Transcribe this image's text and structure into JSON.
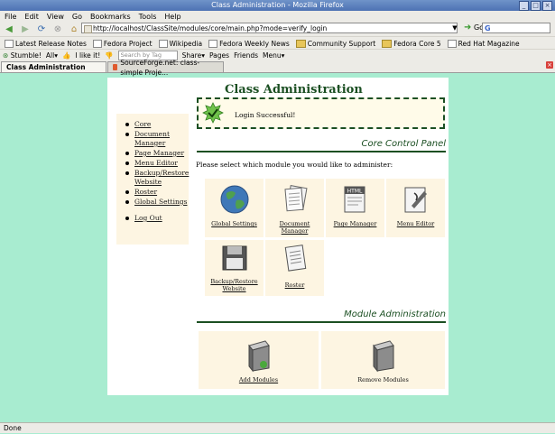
{
  "window": {
    "title": "Class Administration - Mozilla Firefox",
    "controls": [
      "_",
      "□",
      "×"
    ]
  },
  "menu": [
    "File",
    "Edit",
    "View",
    "Go",
    "Bookmarks",
    "Tools",
    "Help"
  ],
  "nav": {
    "url": "http://localhost/ClassSite/modules/core/main.php?mode=verify_login",
    "go_label": "Go",
    "search_value": "G"
  },
  "bookmarks": [
    "Latest Release Notes",
    "Fedora Project",
    "Wikipedia",
    "Fedora Weekly News",
    "Community Support",
    "Fedora Core 5",
    "Red Hat Magazine"
  ],
  "toolbar2": {
    "stumble": "Stumble!",
    "all": "All",
    "ilike": "I like it!",
    "tag_placeholder": "Search by Tag here",
    "share": "Share",
    "pages": "Pages",
    "friends": "Friends",
    "menu": "Menu"
  },
  "tabs": [
    {
      "label": "Class Administration",
      "active": true
    },
    {
      "label": "SourceForge.net: class-simple Proje...",
      "active": false
    }
  ],
  "page": {
    "title": "Class Administration",
    "message": "Login Successful!",
    "core_heading": "Core Control Panel",
    "intro": "Please select which module you would like to administer:",
    "module_heading": "Module Administration",
    "sidebar": [
      "Core",
      "Document Manager",
      "Page Manager",
      "Menu Editor",
      "Backup/Restore Website",
      "Roster",
      "Global Settings"
    ],
    "logout": "Log Out",
    "core_tiles": [
      {
        "label": "Global Settings",
        "icon": "globe-icon"
      },
      {
        "label": "Document Manager",
        "icon": "documents-icon"
      },
      {
        "label": "Page Manager",
        "icon": "html-page-icon"
      },
      {
        "label": "Menu Editor",
        "icon": "menu-editor-icon"
      },
      {
        "label": "Backup/Restore Website",
        "icon": "floppy-disk-icon"
      },
      {
        "label": "Roster",
        "icon": "roster-icon"
      }
    ],
    "module_tiles": [
      {
        "label": "Add Modules",
        "icon": "add-module-box-icon"
      },
      {
        "label": "Remove Modules",
        "icon": "remove-module-box-icon"
      }
    ]
  },
  "status": "Done",
  "colors": {
    "background": "#a8ecd0",
    "heading_green": "#1b4f22",
    "tile_bg": "#fdf5e2"
  }
}
